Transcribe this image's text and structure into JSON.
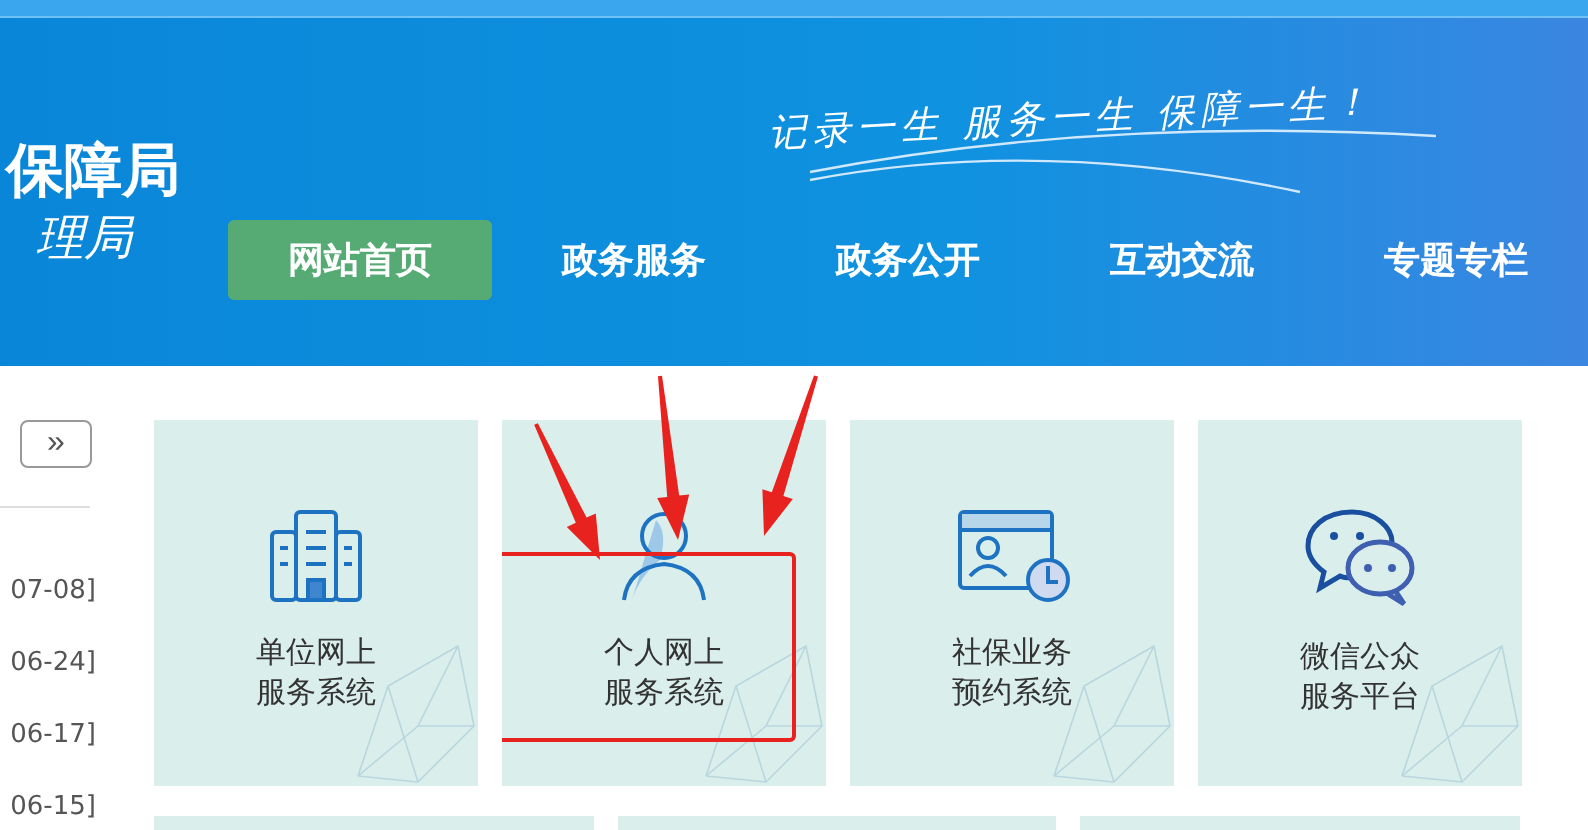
{
  "header": {
    "title_lines": [
      "保障局",
      "理局"
    ],
    "slogan": "记录一生 服务一生 保障一生！",
    "nav": [
      {
        "label": "网站首页",
        "selected": true
      },
      {
        "label": "政务服务",
        "selected": false
      },
      {
        "label": "政务公开",
        "selected": false
      },
      {
        "label": "互动交流",
        "selected": false
      },
      {
        "label": "专题专栏",
        "selected": false
      }
    ]
  },
  "sidebar": {
    "more_button": "»",
    "dates": [
      "07-08]",
      "06-24]",
      "06-17]",
      "06-15]"
    ]
  },
  "services": [
    {
      "kind": "building",
      "label": "单位网上服务系统",
      "highlighted": false
    },
    {
      "kind": "person",
      "label": "个人网上服务系统",
      "highlighted": true
    },
    {
      "kind": "appointment",
      "label": "社保业务预约系统",
      "highlighted": false
    },
    {
      "kind": "chat",
      "label": "微信公众服务平台",
      "highlighted": false
    }
  ]
}
